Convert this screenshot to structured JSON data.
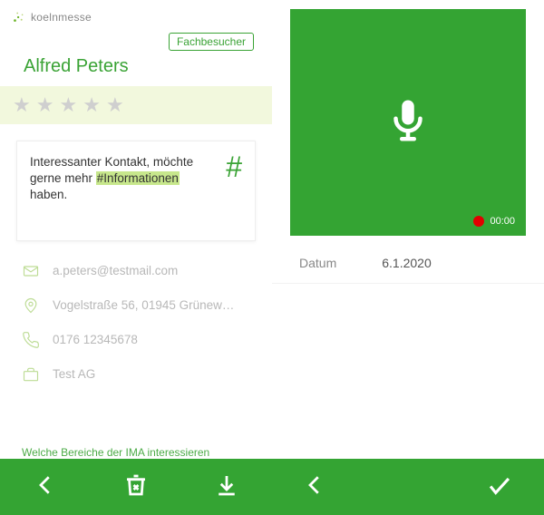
{
  "logo_text": "koelnmesse",
  "badge": "Fachbesucher",
  "contact_name": "Alfred Peters",
  "note": {
    "pre": "Interessanter Kontakt, möchte gerne mehr ",
    "highlight": "#Informationen",
    "post": " haben."
  },
  "info": {
    "email": "a.peters@testmail.com",
    "address": "Vogelstraße 56, 01945 Grünew…",
    "phone": "0176 12345678",
    "company": "Test AG"
  },
  "cutoff_text": "Welche Bereiche der IMA interessieren",
  "recorder": {
    "time": "00:00"
  },
  "date": {
    "label": "Datum",
    "value": "6.1.2020"
  }
}
